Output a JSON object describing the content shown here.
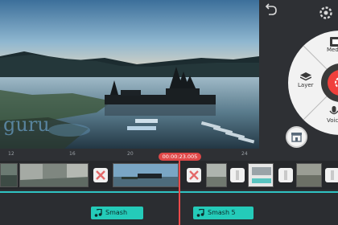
{
  "watermark": {
    "text": "guru"
  },
  "ruler": {
    "ticks": [
      "12",
      "16",
      "20",
      "24"
    ]
  },
  "timeline": {
    "timecode": "00:00:23.005"
  },
  "media_wheel": {
    "items": [
      {
        "label": "Media",
        "icon": "media-icon"
      },
      {
        "label": "Layer",
        "icon": "layer-icon"
      },
      {
        "label": "Voice",
        "icon": "microphone-icon"
      }
    ],
    "record_icon": "camera-icon"
  },
  "audio_clips": [
    {
      "label": "Smash",
      "icon": "music-note-icon"
    },
    {
      "label": "Smash 5",
      "icon": "music-note-icon"
    }
  ],
  "colors": {
    "accent": "#f0403c",
    "audio": "#24cbb9",
    "track_line": "#2fc3c3"
  }
}
